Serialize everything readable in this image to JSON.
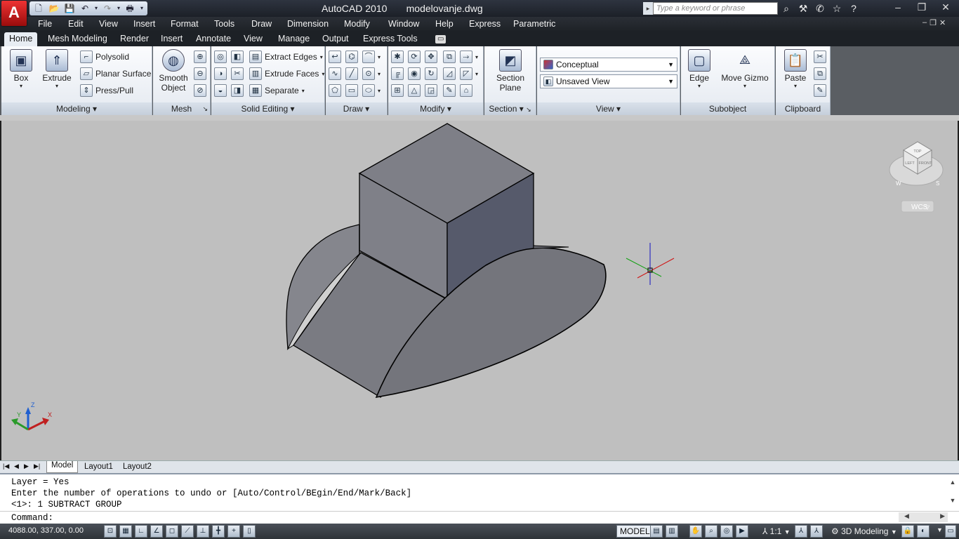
{
  "title": {
    "app": "AutoCAD 2010",
    "document": "modelovanje.dwg",
    "search_placeholder": "Type a keyword or phrase"
  },
  "menu": [
    "File",
    "Edit",
    "View",
    "Insert",
    "Format",
    "Tools",
    "Draw",
    "Dimension",
    "Modify",
    "Window",
    "Help",
    "Express",
    "Parametric"
  ],
  "ribbon_tabs": [
    "Home",
    "Mesh Modeling",
    "Render",
    "Insert",
    "Annotate",
    "View",
    "Manage",
    "Output",
    "Express Tools"
  ],
  "panels": {
    "modeling": {
      "title": "Modeling",
      "box": "Box",
      "extrude": "Extrude",
      "polysolid": "Polysolid",
      "planar_surface": "Planar Surface",
      "press_pull": "Press/Pull"
    },
    "mesh": {
      "title": "Mesh",
      "smooth_object_1": "Smooth",
      "smooth_object_2": "Object"
    },
    "solid_editing": {
      "title": "Solid Editing",
      "extract_edges": "Extract Edges",
      "extrude_faces": "Extrude Faces",
      "separate": "Separate"
    },
    "draw": {
      "title": "Draw"
    },
    "modify": {
      "title": "Modify"
    },
    "section": {
      "title": "Section",
      "section_plane_1": "Section",
      "section_plane_2": "Plane"
    },
    "view": {
      "title": "View",
      "visual_style": "Conceptual",
      "named_view": "Unsaved View"
    },
    "subobject": {
      "title": "Subobject",
      "edge": "Edge",
      "move_gizmo": "Move Gizmo"
    },
    "clipboard": {
      "title": "Clipboard",
      "paste": "Paste"
    }
  },
  "viewcube": {
    "top": "TOP",
    "left": "LEFT",
    "front": "FRONT",
    "compass_w": "W",
    "compass_s": "S",
    "wcs": "WCS"
  },
  "ucs_icon": {
    "x": "X",
    "y": "Y",
    "z": "Z"
  },
  "layout_tabs": [
    "Model",
    "Layout1",
    "Layout2"
  ],
  "command_history": [
    "Layer = Yes",
    "Enter the number of operations to undo or [Auto/Control/BEgin/End/Mark/Back]",
    "<1>: 1 SUBTRACT GROUP"
  ],
  "command_prompt": "Command:",
  "status": {
    "coordinates": "4088.00, 337.00, 0.00",
    "space": "MODEL",
    "scale": "1:1",
    "workspace": "3D Modeling"
  },
  "colors": {
    "viewport_bg": "#bfbfbf",
    "solid_top": "#7a7a82",
    "solid_right": "#55596a",
    "solid_left": "#7e7f86"
  }
}
